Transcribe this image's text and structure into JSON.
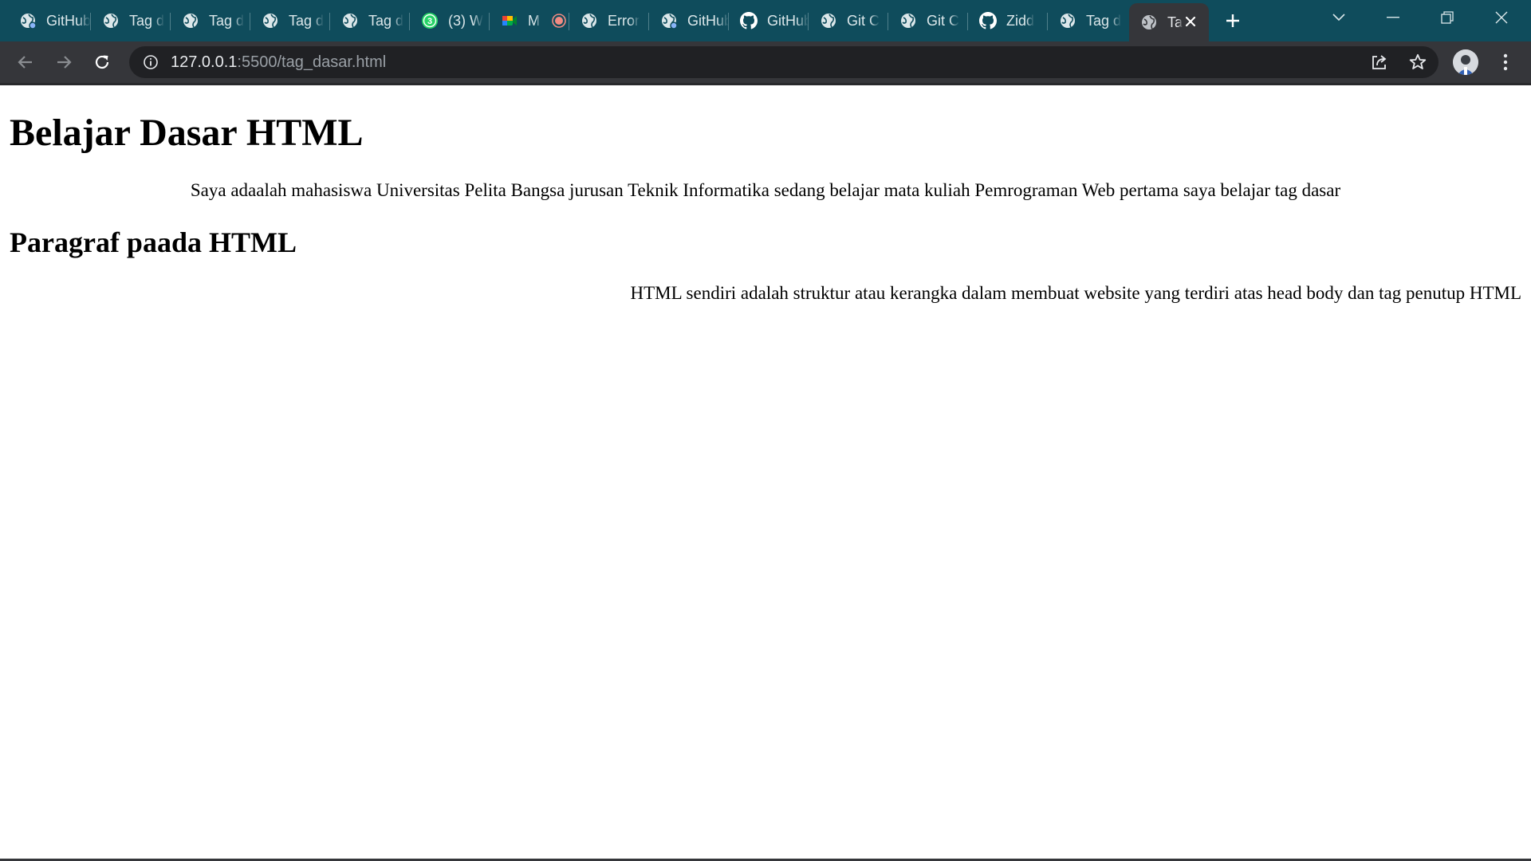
{
  "browser": {
    "tabs": [
      {
        "title": "GitHub",
        "icon": "globe-icon"
      },
      {
        "title": "Tag d",
        "icon": "globe-icon"
      },
      {
        "title": "Tag d",
        "icon": "globe-icon"
      },
      {
        "title": "Tag d",
        "icon": "globe-icon"
      },
      {
        "title": "Tag d",
        "icon": "globe-icon"
      },
      {
        "title": "(3) W",
        "icon": "whatsapp-icon",
        "badge": "3"
      },
      {
        "title": "M",
        "icon": "meet-icon"
      },
      {
        "title": "Error",
        "icon": "globe-icon"
      },
      {
        "title": "GitHub",
        "icon": "globe-icon"
      },
      {
        "title": "GitHub",
        "icon": "github-icon"
      },
      {
        "title": "Git C",
        "icon": "globe-icon"
      },
      {
        "title": "Git C",
        "icon": "globe-icon"
      },
      {
        "title": "Zidd",
        "icon": "github-icon"
      },
      {
        "title": "Tag d",
        "icon": "globe-icon"
      },
      {
        "title": "Ta",
        "icon": "globe-icon",
        "active": true
      }
    ],
    "url_host": "127.0.0.1",
    "url_rest": ":5500/tag_dasar.html",
    "colors": {
      "tabstrip": "#0f4c5c",
      "toolbar": "#35363a",
      "omnibox": "#202124",
      "recording": "#f28b82"
    }
  },
  "page": {
    "heading1": "Belajar Dasar HTML",
    "paragraph1": "Saya adaalah mahasiswa Universitas Pelita Bangsa jurusan Teknik Informatika sedang belajar mata kuliah Pemrograman Web pertama saya belajar tag dasar",
    "heading2": "Paragraf paada HTML",
    "paragraph2": "HTML sendiri adalah struktur atau kerangka dalam membuat website yang terdiri atas head body dan tag penutup HTML"
  }
}
